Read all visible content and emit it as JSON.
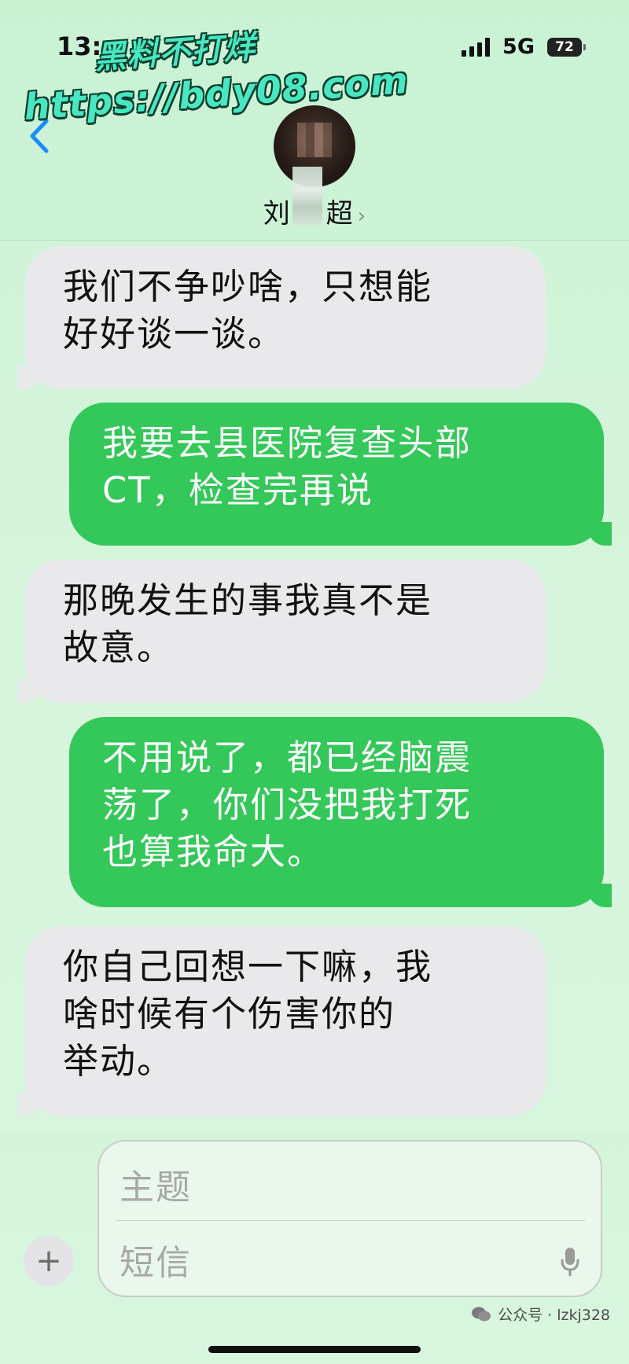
{
  "status_bar": {
    "time": "13:",
    "network": "5G",
    "battery": "72"
  },
  "watermark": {
    "line1": "黑料不打烊",
    "line2": "https://bdy08.com"
  },
  "header": {
    "contact_name_part1": "刘",
    "contact_name_part2": "超",
    "chevron": "›"
  },
  "messages": [
    {
      "direction": "incoming",
      "lines": [
        "我们不争吵啥，只想能",
        "好好谈一谈。"
      ]
    },
    {
      "direction": "outgoing",
      "lines": [
        "我要去县医院复查头部",
        "CT，检查完再说"
      ]
    },
    {
      "direction": "incoming",
      "lines": [
        "那晚发生的事我真不是",
        "故意。"
      ]
    },
    {
      "direction": "outgoing",
      "lines": [
        "不用说了，都已经脑震",
        "荡了，你们没把我打死",
        "也算我命大。"
      ]
    },
    {
      "direction": "incoming",
      "lines": [
        "你自己回想一下嘛，我",
        "啥时候有个伤害你的",
        "举动。"
      ]
    }
  ],
  "composer": {
    "subject_placeholder": "主题",
    "message_placeholder": "短信",
    "plus": "+"
  },
  "footer": {
    "source": "公众号 · lzkj328"
  },
  "colors": {
    "outgoing_bubble": "#34c759",
    "incoming_bubble": "#e9e9eb",
    "back_arrow": "#1a8cff"
  }
}
